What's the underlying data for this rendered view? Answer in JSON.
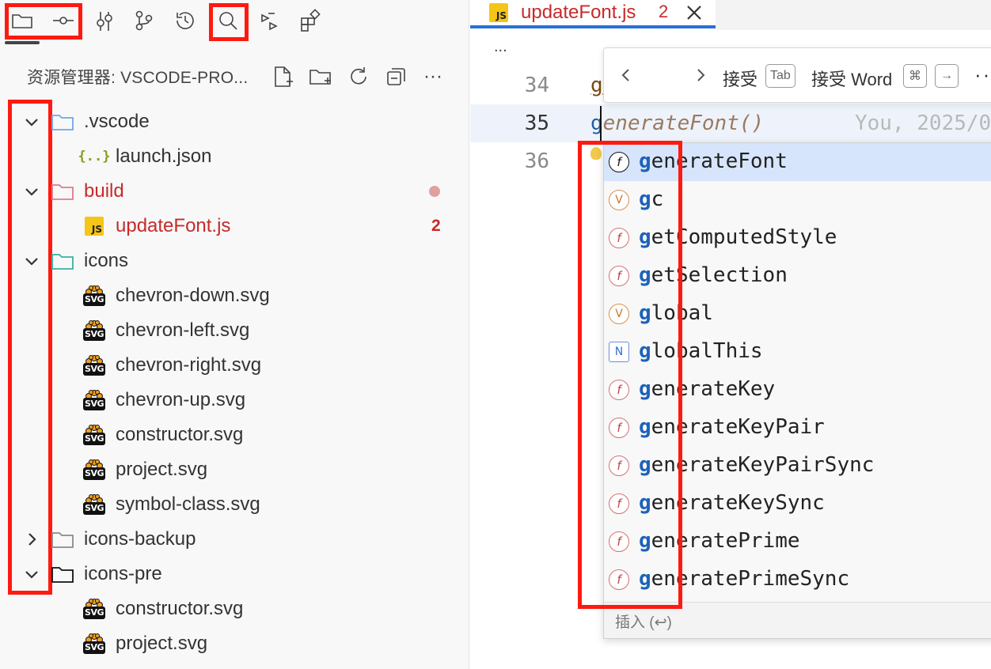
{
  "sidebar": {
    "explorer_title": "资源管理器: VSCODE-PRO...",
    "header_more": "···",
    "tree": [
      {
        "label": ".vscode",
        "kind": "folder",
        "expanded": true,
        "color": "default"
      },
      {
        "label": "launch.json",
        "kind": "json",
        "color": "default"
      },
      {
        "label": "build",
        "kind": "folder",
        "expanded": true,
        "color": "red",
        "badge": "dot"
      },
      {
        "label": "updateFont.js",
        "kind": "js",
        "color": "red",
        "badge": "2"
      },
      {
        "label": "icons",
        "kind": "folder",
        "expanded": true,
        "color": "default"
      },
      {
        "label": "chevron-down.svg",
        "kind": "svg"
      },
      {
        "label": "chevron-left.svg",
        "kind": "svg"
      },
      {
        "label": "chevron-right.svg",
        "kind": "svg"
      },
      {
        "label": "chevron-up.svg",
        "kind": "svg"
      },
      {
        "label": "constructor.svg",
        "kind": "svg"
      },
      {
        "label": "project.svg",
        "kind": "svg"
      },
      {
        "label": "symbol-class.svg",
        "kind": "svg"
      },
      {
        "label": "icons-backup",
        "kind": "folder",
        "expanded": false
      },
      {
        "label": "icons-pre",
        "kind": "folder",
        "expanded": true
      },
      {
        "label": "constructor.svg",
        "kind": "svg"
      },
      {
        "label": "project.svg",
        "kind": "svg"
      }
    ],
    "svg_icon_text": "SVG",
    "js_icon_text": "JS",
    "json_icon_text": "{..}"
  },
  "editor": {
    "tab": {
      "name": "updateFont.js",
      "problems": "2",
      "icon_text": "JS"
    },
    "breadcrumb": "...",
    "lines": [
      {
        "number": "34",
        "text": "g"
      },
      {
        "number": "35",
        "typed": "g",
        "ghost": "enerateFont()",
        "blame": "You, 2025/0"
      },
      {
        "number": "36",
        "text": ""
      }
    ],
    "inline_toolbar": {
      "accept_label": "接受",
      "accept_key": "Tab",
      "accept_word_label": "接受 Word",
      "cmd_key": "⌘",
      "arrow_key": "→",
      "more": "···"
    },
    "suggestions": [
      {
        "prefix": "g",
        "rest": "enerateFont",
        "kind": "f",
        "selected": true
      },
      {
        "prefix": "g",
        "rest": "c",
        "kind": "v"
      },
      {
        "prefix": "g",
        "rest": "etComputedStyle",
        "kind": "f"
      },
      {
        "prefix": "g",
        "rest": "etSelection",
        "kind": "f"
      },
      {
        "prefix": "g",
        "rest": "lobal",
        "kind": "v"
      },
      {
        "prefix": "g",
        "rest": "lobalThis",
        "kind": "n"
      },
      {
        "prefix": "g",
        "rest": "enerateKey",
        "kind": "f"
      },
      {
        "prefix": "g",
        "rest": "enerateKeyPair",
        "kind": "f"
      },
      {
        "prefix": "g",
        "rest": "enerateKeyPairSync",
        "kind": "f"
      },
      {
        "prefix": "g",
        "rest": "enerateKeySync",
        "kind": "f"
      },
      {
        "prefix": "g",
        "rest": "eneratePrime",
        "kind": "f"
      },
      {
        "prefix": "g",
        "rest": "eneratePrimeSync",
        "kind": "f"
      }
    ],
    "kind_glyphs": {
      "f": "f",
      "v": "V",
      "n": "N"
    },
    "insert_hint": "插入 (↩)"
  },
  "colors": {
    "accent": "#2870d8",
    "error": "#c72a2a",
    "highlight_box": "#ff1a10",
    "selection": "#d6e5fb"
  }
}
